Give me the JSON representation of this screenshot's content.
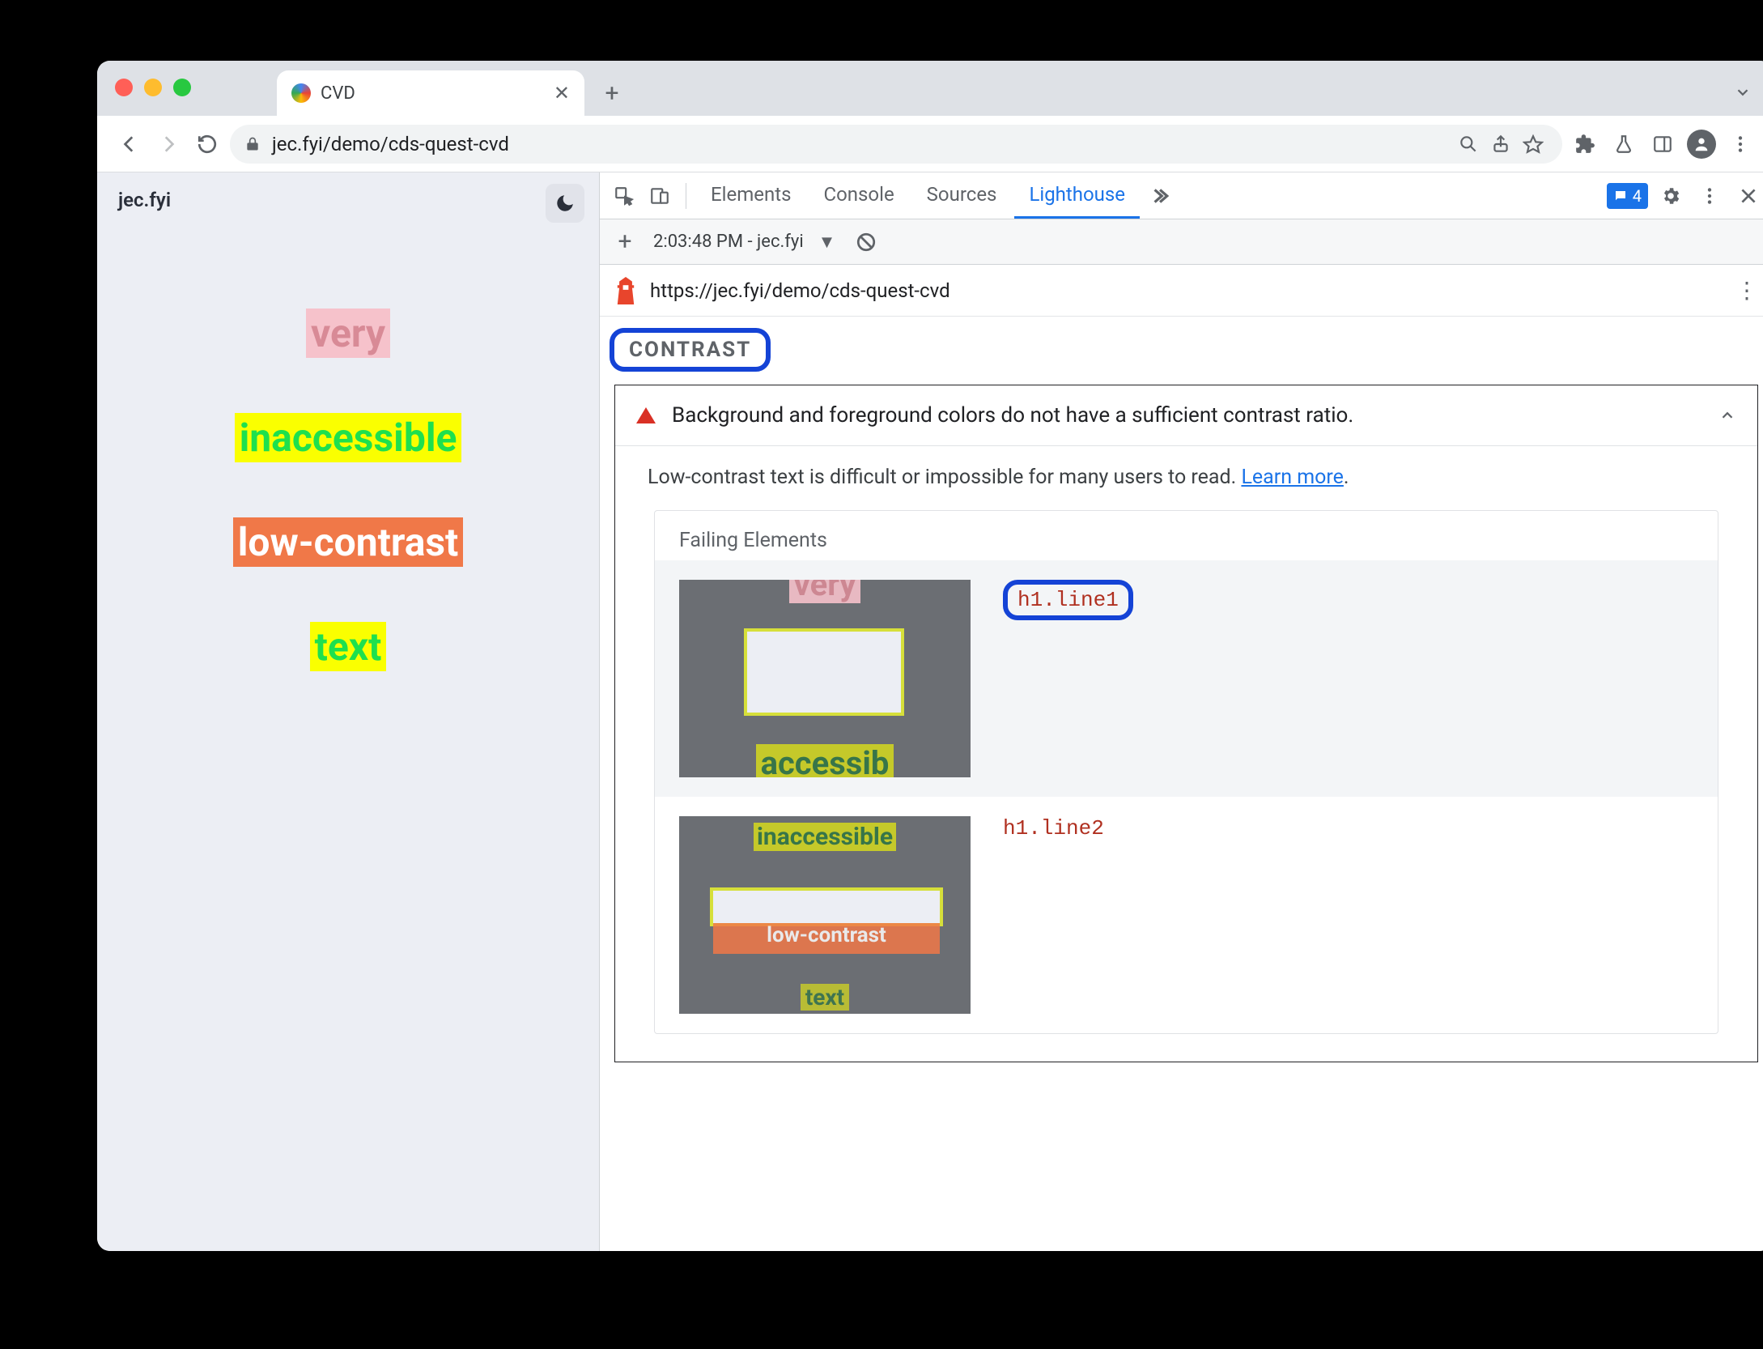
{
  "browser": {
    "tab_title": "CVD",
    "url_display": "jec.fyi/demo/cds-quest-cvd"
  },
  "page": {
    "site_title": "jec.fyi",
    "lines": [
      "very",
      "inaccessible",
      "low-contrast",
      "text"
    ]
  },
  "devtools": {
    "tabs": [
      "Elements",
      "Console",
      "Sources",
      "Lighthouse"
    ],
    "active_tab": "Lighthouse",
    "feedback_count": "4",
    "sub": {
      "report_label": "2:03:48 PM - jec.fyi"
    },
    "report_url": "https://jec.fyi/demo/cds-quest-cvd",
    "section": "CONTRAST",
    "audit": {
      "title": "Background and foreground colors do not have a sufficient contrast ratio.",
      "description_prefix": "Low-contrast text is difficult or impossible for many users to read. ",
      "learn_more": "Learn more",
      "description_suffix": ".",
      "failing_label": "Failing Elements",
      "items": [
        {
          "selector": "h1.line1"
        },
        {
          "selector": "h1.line2"
        }
      ]
    }
  }
}
